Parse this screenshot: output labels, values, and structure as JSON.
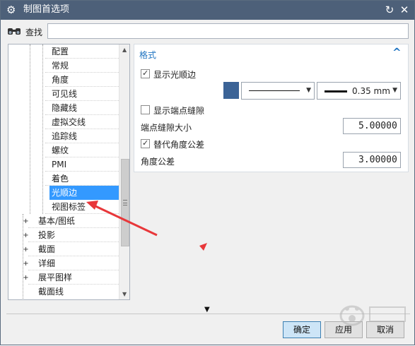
{
  "window": {
    "title": "制图首选项",
    "icons": {
      "app": "gear-icon",
      "reset": "reset-icon",
      "close": "close-icon"
    }
  },
  "search": {
    "label": "查找",
    "value": "",
    "icon": "binoculars-icon"
  },
  "tree": {
    "children": [
      {
        "label": "配置"
      },
      {
        "label": "常规"
      },
      {
        "label": "角度"
      },
      {
        "label": "可见线"
      },
      {
        "label": "隐藏线"
      },
      {
        "label": "虚拟交线"
      },
      {
        "label": "追踪线"
      },
      {
        "label": "螺纹"
      },
      {
        "label": "PMI"
      },
      {
        "label": "着色"
      },
      {
        "label": "光顺边",
        "selected": true
      },
      {
        "label": "视图标签"
      }
    ],
    "groups": [
      {
        "label": "基本/图纸",
        "expander": "+"
      },
      {
        "label": "投影",
        "expander": "+"
      },
      {
        "label": "截面",
        "expander": "+"
      },
      {
        "label": "详细",
        "expander": "+"
      },
      {
        "label": "展平图样",
        "expander": "+"
      },
      {
        "label": "截面线",
        "expander": ""
      }
    ]
  },
  "format": {
    "section_title": "格式",
    "show_smooth_edge": {
      "label": "显示光顺边",
      "checked": true
    },
    "line_color": "#3b6396",
    "line_font": "solid",
    "line_width": "0.35 mm",
    "show_endpoint_gap": {
      "label": "显示端点缝隙",
      "checked": false
    },
    "endpoint_gap_size": {
      "label": "端点缝隙大小",
      "value": "5.00000"
    },
    "substitute_angle_tol": {
      "label": "替代角度公差",
      "checked": true
    },
    "angle_tolerance": {
      "label": "角度公差",
      "value": "3.00000"
    }
  },
  "buttons": {
    "ok": "确定",
    "apply": "应用",
    "cancel": "取消"
  },
  "colors": {
    "titlebar": "#4d6079",
    "section_title": "#1f74c2",
    "selection": "#3399ff",
    "annotation_arrow": "#e8373a"
  }
}
